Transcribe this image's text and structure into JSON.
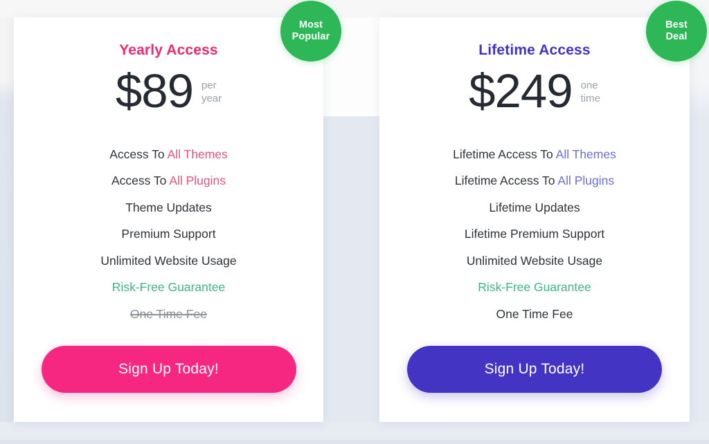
{
  "page": {
    "background_color": "#e4e9f1",
    "card_background": "#ffffff"
  },
  "plans": [
    {
      "id": "yearly",
      "badge": {
        "line1": "Most",
        "line2": "Popular",
        "color": "#2db757"
      },
      "title": "Yearly Access",
      "title_color": "#e82b72",
      "price": "$89",
      "period_line1": "per",
      "period_line2": "year",
      "features": [
        {
          "prefix": "Access To ",
          "highlight": "All Themes",
          "style": "highlight-pink"
        },
        {
          "prefix": "Access To ",
          "highlight": "All Plugins",
          "style": "highlight-pink"
        },
        {
          "prefix": "Theme Updates",
          "highlight": "",
          "style": "normal"
        },
        {
          "prefix": "Premium Support",
          "highlight": "",
          "style": "normal"
        },
        {
          "prefix": "Unlimited Website Usage",
          "highlight": "",
          "style": "normal"
        },
        {
          "prefix": "Risk-Free Guarantee",
          "highlight": "",
          "style": "green"
        },
        {
          "prefix": "One Time Fee",
          "highlight": "",
          "style": "struck"
        }
      ],
      "cta_label": "Sign Up Today!",
      "cta_color": "#f62780"
    },
    {
      "id": "lifetime",
      "badge": {
        "line1": "Best",
        "line2": "Deal",
        "color": "#2db757"
      },
      "title": "Lifetime Access",
      "title_color": "#4334c4",
      "price": "$249",
      "period_line1": "one",
      "period_line2": "time",
      "features": [
        {
          "prefix": "Lifetime Access To ",
          "highlight": "All Themes",
          "style": "highlight-indigo"
        },
        {
          "prefix": "Lifetime Access To ",
          "highlight": "All Plugins",
          "style": "highlight-indigo"
        },
        {
          "prefix": "Lifetime Updates",
          "highlight": "",
          "style": "normal"
        },
        {
          "prefix": "Lifetime Premium Support",
          "highlight": "",
          "style": "normal"
        },
        {
          "prefix": "Unlimited Website Usage",
          "highlight": "",
          "style": "normal"
        },
        {
          "prefix": "Risk-Free Guarantee",
          "highlight": "",
          "style": "green"
        },
        {
          "prefix": "One Time Fee",
          "highlight": "",
          "style": "normal"
        }
      ],
      "cta_label": "Sign Up Today!",
      "cta_color": "#4334c4"
    }
  ]
}
